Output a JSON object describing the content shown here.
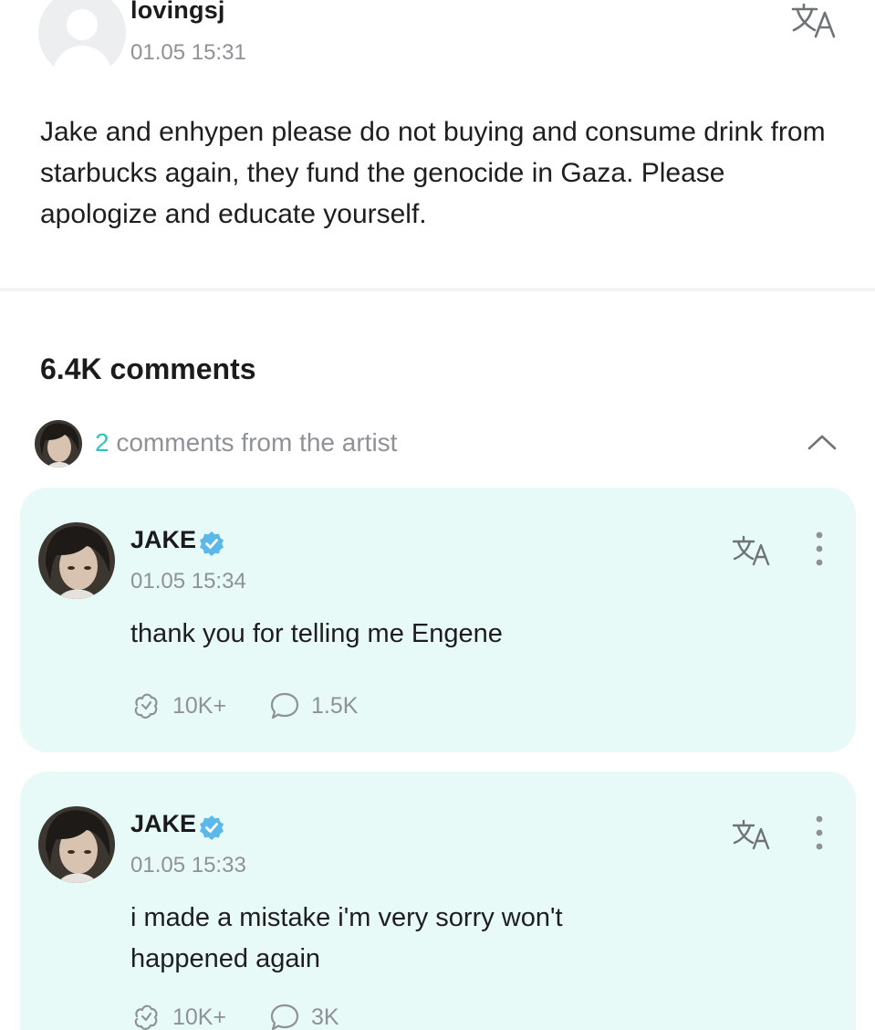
{
  "post": {
    "username": "lovingsj",
    "timestamp": "01.05 15:31",
    "text": "Jake and enhypen please do not buying and consume drink from starbucks again, they fund the genocide in Gaza. Please apologize and educate yourself."
  },
  "comments_section": {
    "count_label": "6.4K comments",
    "artist_row": {
      "count": "2",
      "label": "comments from the artist"
    }
  },
  "comments": [
    {
      "name": "JAKE",
      "verified": true,
      "timestamp": "01.05 15:34",
      "text": "thank you for telling me Engene",
      "likes": "10K+",
      "replies": "1.5K"
    },
    {
      "name": "JAKE",
      "verified": true,
      "timestamp": "01.05 15:33",
      "text": "i made a mistake i'm very sorry won't happened again",
      "likes": "10K+",
      "replies": "3K"
    }
  ],
  "colors": {
    "accent": "#2ec4c4",
    "card_bg": "#e8faf7",
    "muted_text": "#8e9296",
    "verified": "#5ab8ea"
  },
  "icons": [
    "translate-icon",
    "more-vertical-icon",
    "like-icon",
    "reply-icon",
    "verified-badge-icon",
    "chevron-up-icon"
  ]
}
